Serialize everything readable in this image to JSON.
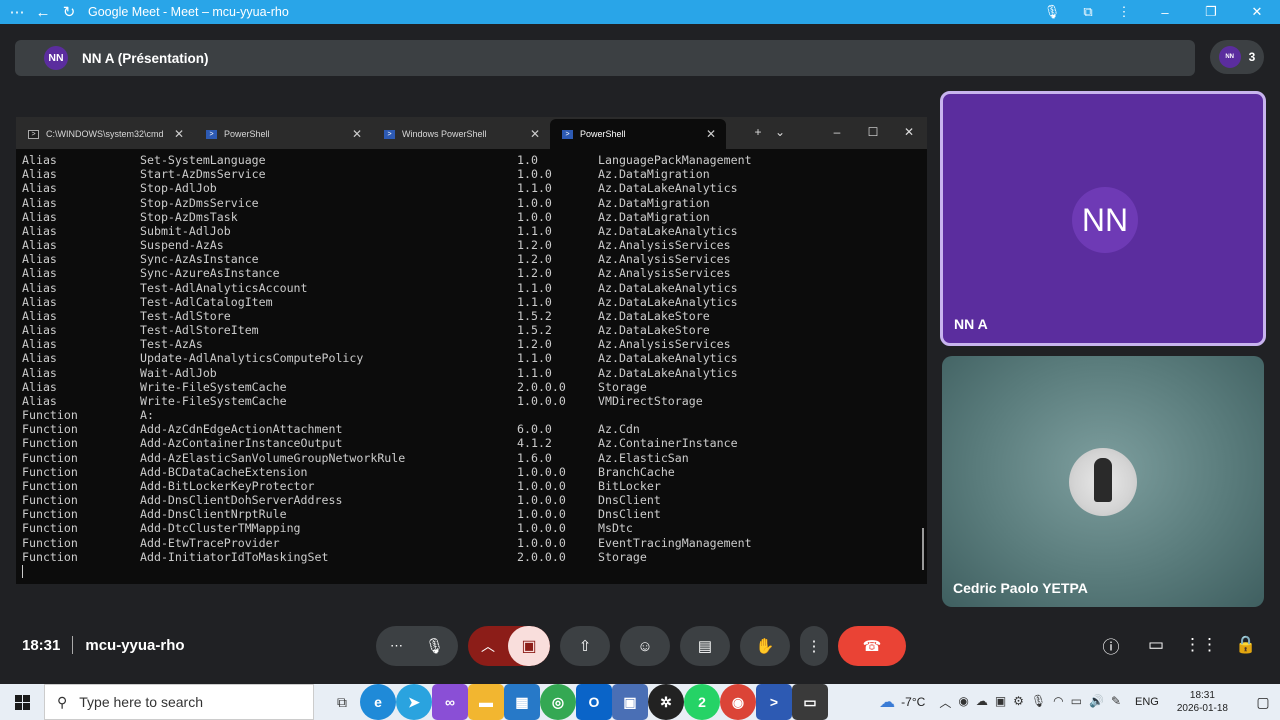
{
  "browser": {
    "title": "Google Meet - Meet – mcu-yyua-rho"
  },
  "presenter": {
    "initials": "NN",
    "banner_text": "NN A (Présentation)"
  },
  "participants": {
    "count": "3",
    "mini_initials": "NN"
  },
  "terminal": {
    "tabs": [
      {
        "label": "C:\\WINDOWS\\system32\\cmd",
        "icon": "cmd-icon",
        "active": false
      },
      {
        "label": "PowerShell",
        "icon": "powershell-icon",
        "active": false
      },
      {
        "label": "Windows PowerShell",
        "icon": "powershell-icon",
        "active": false
      },
      {
        "label": "PowerShell",
        "icon": "powershell-icon",
        "active": true
      }
    ],
    "rows": [
      [
        "Alias",
        "Set-SystemLanguage",
        "1.0",
        "LanguagePackManagement"
      ],
      [
        "Alias",
        "Start-AzDmsService",
        "1.0.0",
        "Az.DataMigration"
      ],
      [
        "Alias",
        "Stop-AdlJob",
        "1.1.0",
        "Az.DataLakeAnalytics"
      ],
      [
        "Alias",
        "Stop-AzDmsService",
        "1.0.0",
        "Az.DataMigration"
      ],
      [
        "Alias",
        "Stop-AzDmsTask",
        "1.0.0",
        "Az.DataMigration"
      ],
      [
        "Alias",
        "Submit-AdlJob",
        "1.1.0",
        "Az.DataLakeAnalytics"
      ],
      [
        "Alias",
        "Suspend-AzAs",
        "1.2.0",
        "Az.AnalysisServices"
      ],
      [
        "Alias",
        "Sync-AzAsInstance",
        "1.2.0",
        "Az.AnalysisServices"
      ],
      [
        "Alias",
        "Sync-AzureAsInstance",
        "1.2.0",
        "Az.AnalysisServices"
      ],
      [
        "Alias",
        "Test-AdlAnalyticsAccount",
        "1.1.0",
        "Az.DataLakeAnalytics"
      ],
      [
        "Alias",
        "Test-AdlCatalogItem",
        "1.1.0",
        "Az.DataLakeAnalytics"
      ],
      [
        "Alias",
        "Test-AdlStore",
        "1.5.2",
        "Az.DataLakeStore"
      ],
      [
        "Alias",
        "Test-AdlStoreItem",
        "1.5.2",
        "Az.DataLakeStore"
      ],
      [
        "Alias",
        "Test-AzAs",
        "1.2.0",
        "Az.AnalysisServices"
      ],
      [
        "Alias",
        "Update-AdlAnalyticsComputePolicy",
        "1.1.0",
        "Az.DataLakeAnalytics"
      ],
      [
        "Alias",
        "Wait-AdlJob",
        "1.1.0",
        "Az.DataLakeAnalytics"
      ],
      [
        "Alias",
        "Write-FileSystemCache",
        "2.0.0.0",
        "Storage"
      ],
      [
        "Alias",
        "Write-FileSystemCache",
        "1.0.0.0",
        "VMDirectStorage"
      ],
      [
        "Function",
        "A:",
        "",
        ""
      ],
      [
        "Function",
        "Add-AzCdnEdgeActionAttachment",
        "6.0.0",
        "Az.Cdn"
      ],
      [
        "Function",
        "Add-AzContainerInstanceOutput",
        "4.1.2",
        "Az.ContainerInstance"
      ],
      [
        "Function",
        "Add-AzElasticSanVolumeGroupNetworkRule",
        "1.6.0",
        "Az.ElasticSan"
      ],
      [
        "Function",
        "Add-BCDataCacheExtension",
        "1.0.0.0",
        "BranchCache"
      ],
      [
        "Function",
        "Add-BitLockerKeyProtector",
        "1.0.0.0",
        "BitLocker"
      ],
      [
        "Function",
        "Add-DnsClientDohServerAddress",
        "1.0.0.0",
        "DnsClient"
      ],
      [
        "Function",
        "Add-DnsClientNrptRule",
        "1.0.0.0",
        "DnsClient"
      ],
      [
        "Function",
        "Add-DtcClusterTMMapping",
        "1.0.0.0",
        "MsDtc"
      ],
      [
        "Function",
        "Add-EtwTraceProvider",
        "1.0.0.0",
        "EventTracingManagement"
      ],
      [
        "Function",
        "Add-InitiatorIdToMaskingSet",
        "2.0.0.0",
        "Storage"
      ]
    ]
  },
  "tiles": {
    "nna": {
      "initials": "NN",
      "name": "NN A"
    },
    "cedric": {
      "name": "Cedric Paolo YETPA"
    }
  },
  "meeting": {
    "time": "18:31",
    "code": "mcu-yyua-rho"
  },
  "taskbar": {
    "search_placeholder": "Type here to search",
    "weather": "-7°C",
    "language": "ENG",
    "time": "18:31",
    "date": "2026-01-18",
    "whatsapp_badge": "2"
  },
  "colors": {
    "titlebar": "#29a5e8",
    "presenter_tile": "#5b2d9e",
    "end_call": "#ea4335",
    "camera_off": "#8c1d18"
  }
}
